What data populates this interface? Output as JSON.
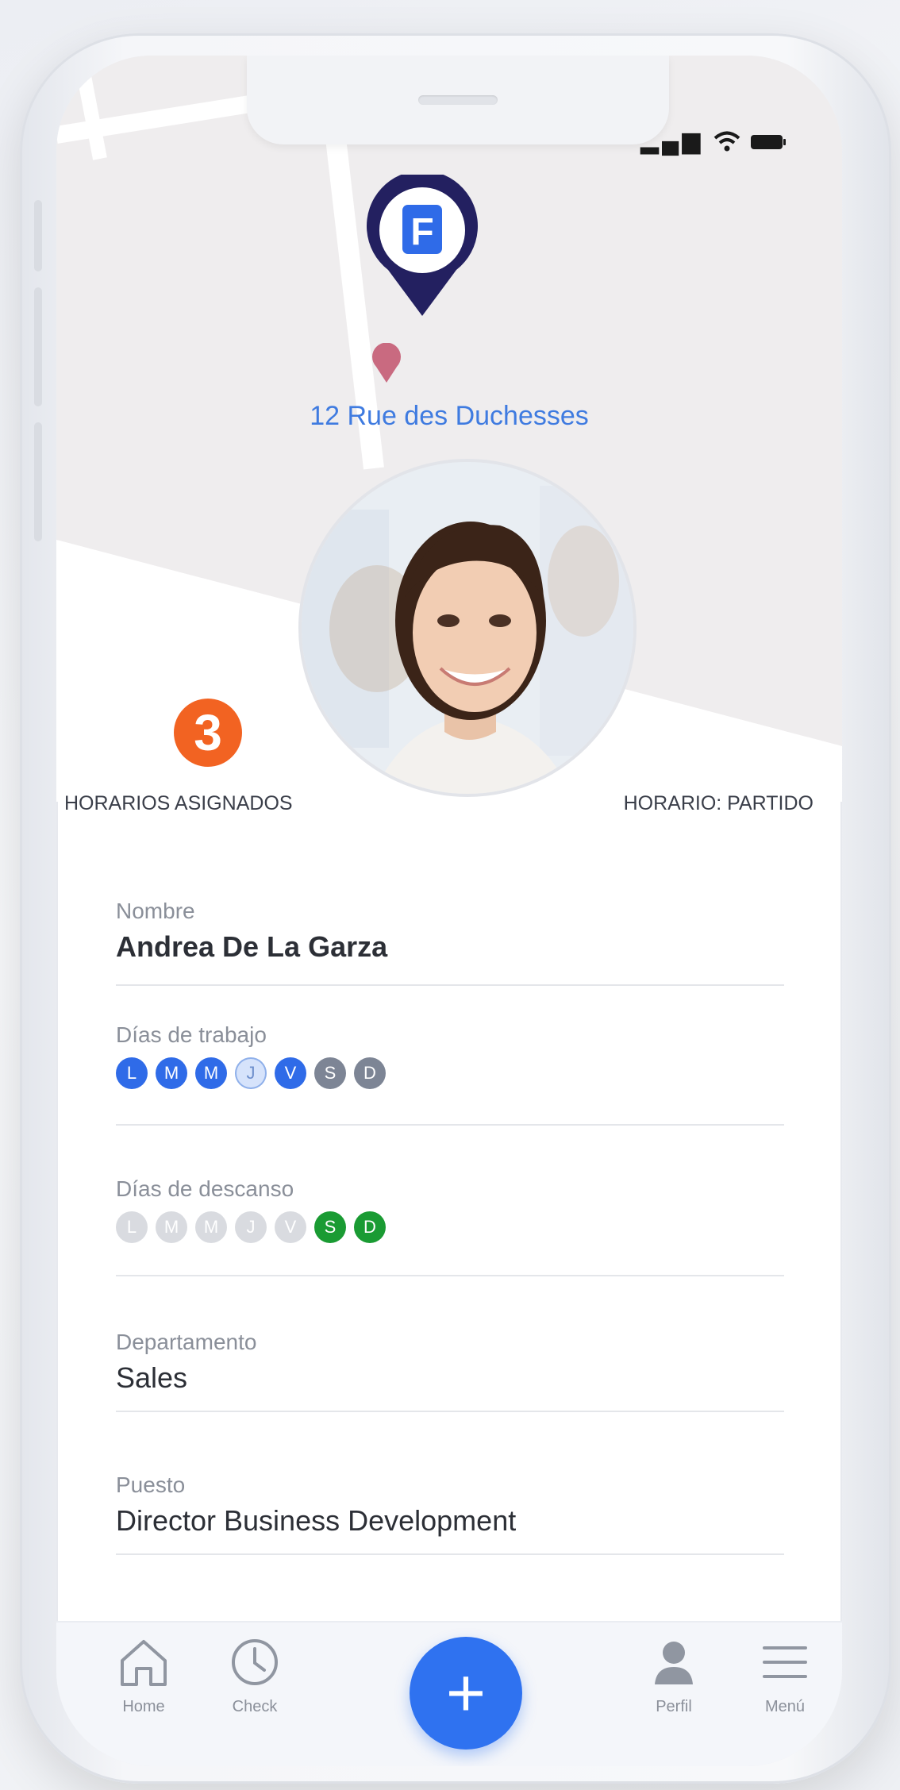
{
  "status": {
    "signal": "▂▄▆",
    "wifi": "wifi-icon",
    "battery": "battery-icon"
  },
  "map": {
    "address": "12 Rue des Duchesses",
    "logo_letter": "F"
  },
  "profile": {
    "assigned_count": "3",
    "assigned_label": "HORARIOS ASIGNADOS",
    "schedule_label": "HORARIO: PARTIDO"
  },
  "fields": {
    "name": {
      "label": "Nombre",
      "value": "Andrea De La Garza"
    },
    "work_days": {
      "label": "Días de trabajo",
      "days": [
        "L",
        "M",
        "M",
        "J",
        "V",
        "S",
        "D"
      ]
    },
    "rest_days": {
      "label": "Días de descanso",
      "days": [
        "L",
        "M",
        "M",
        "J",
        "V",
        "S",
        "D"
      ]
    },
    "department": {
      "label": "Departamento",
      "value": "Sales"
    },
    "position": {
      "label": "Puesto",
      "value": "Director Business Development"
    }
  },
  "colors": {
    "accent": "#2f72f0",
    "counter": "#f26322",
    "rest": "#1a9b33",
    "address": "#3f7be0"
  },
  "tabbar": {
    "home": "Home",
    "check": "Check",
    "add": "+",
    "profile": "Perfil",
    "menu": "Menú"
  }
}
